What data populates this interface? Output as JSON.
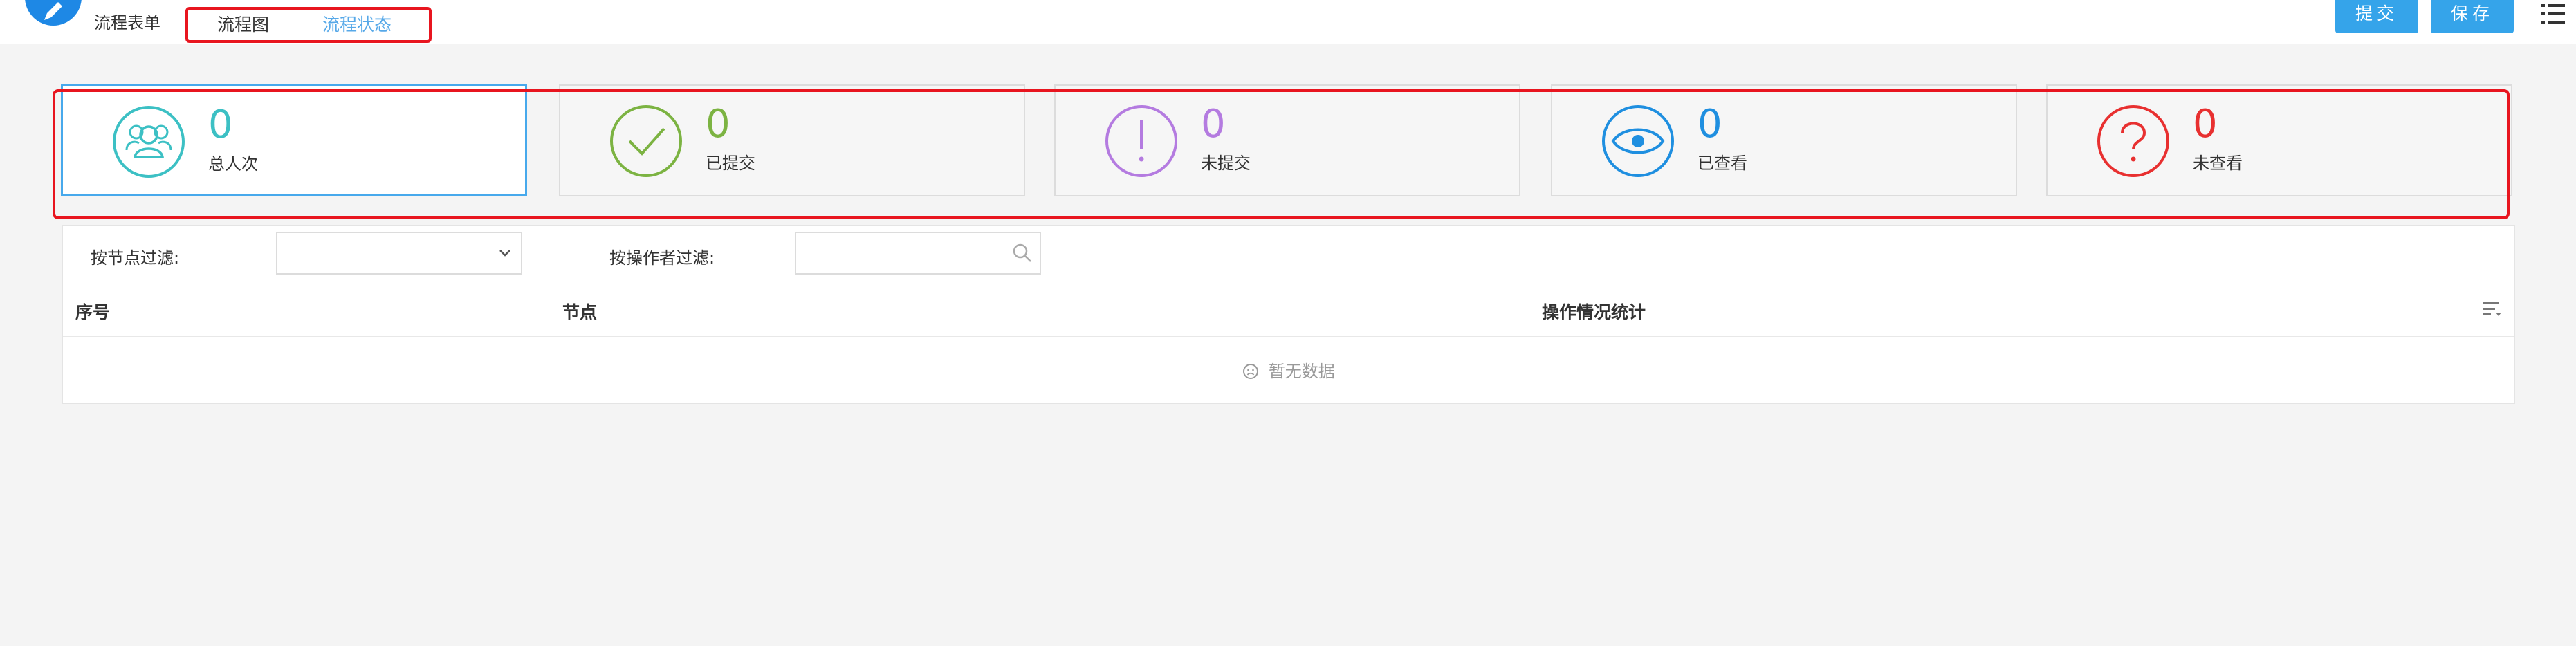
{
  "header": {
    "app_title": "流程表单",
    "tabs": [
      {
        "label": "流程图",
        "active": false
      },
      {
        "label": "流程状态",
        "active": true
      }
    ],
    "submit_label": "提交",
    "save_label": "保存",
    "logo_icon": "pen-icon",
    "menu_icon": "list-menu-icon"
  },
  "stats": [
    {
      "value": "0",
      "label": "总人次",
      "icon": "users-icon",
      "color": "#3cc0c4"
    },
    {
      "value": "0",
      "label": "已提交",
      "icon": "check-circle-icon",
      "color": "#7cb342"
    },
    {
      "value": "0",
      "label": "未提交",
      "icon": "exclamation-circle-icon",
      "color": "#b47be0"
    },
    {
      "value": "0",
      "label": "已查看",
      "icon": "eye-icon",
      "color": "#1f8fe0"
    },
    {
      "value": "0",
      "label": "未查看",
      "icon": "question-circle-icon",
      "color": "#e83030"
    }
  ],
  "filters": {
    "node_label": "按节点过滤:",
    "node_value": "",
    "operator_label": "按操作者过滤:",
    "operator_value": "",
    "operator_placeholder": ""
  },
  "table": {
    "columns": [
      "序号",
      "节点",
      "操作情况统计"
    ],
    "rows": [],
    "empty_text": "暂无数据"
  },
  "colors": {
    "primary": "#35a4ea",
    "highlight": "#e8151f",
    "active_tab": "#56a8e8"
  }
}
